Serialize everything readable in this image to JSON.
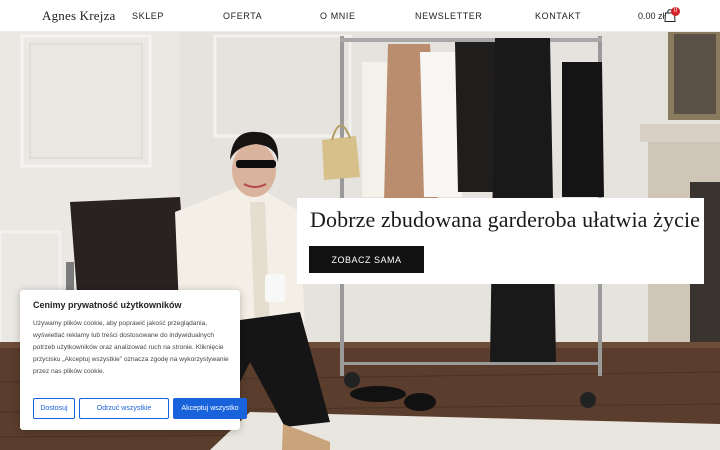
{
  "header": {
    "logo": "Agnes Krejza",
    "nav": [
      "SKLEP",
      "OFERTA",
      "O MNIE",
      "NEWSLETTER",
      "KONTAKT"
    ],
    "cart_total": "0.00 zł",
    "cart_count": "0",
    "cart_icon": "shopping-bag-icon"
  },
  "hero": {
    "headline": "Dobrze zbudowana garderoba ułatwia życie",
    "cta_label": "ZOBACZ SAMA"
  },
  "cookie": {
    "title": "Cenimy prywatność użytkowników",
    "text": "Używamy plików cookie, aby poprawić jakość przeglądania, wyświetlać reklamy lub treści dostosowane do indywidualnych potrzeb użytkowników oraz analizować ruch na stronie. Kliknięcie przycisku „Akceptuj wszystkie” oznacza zgodę na wykorzystywanie przez nas plików cookie.",
    "customize_label": "Dostosuj",
    "reject_label": "Odrzuć wszystkie",
    "accept_label": "Akceptuj wszystko"
  },
  "colors": {
    "accent": "#1863dc",
    "badge": "#d2232a",
    "cta_bg": "#111111"
  }
}
